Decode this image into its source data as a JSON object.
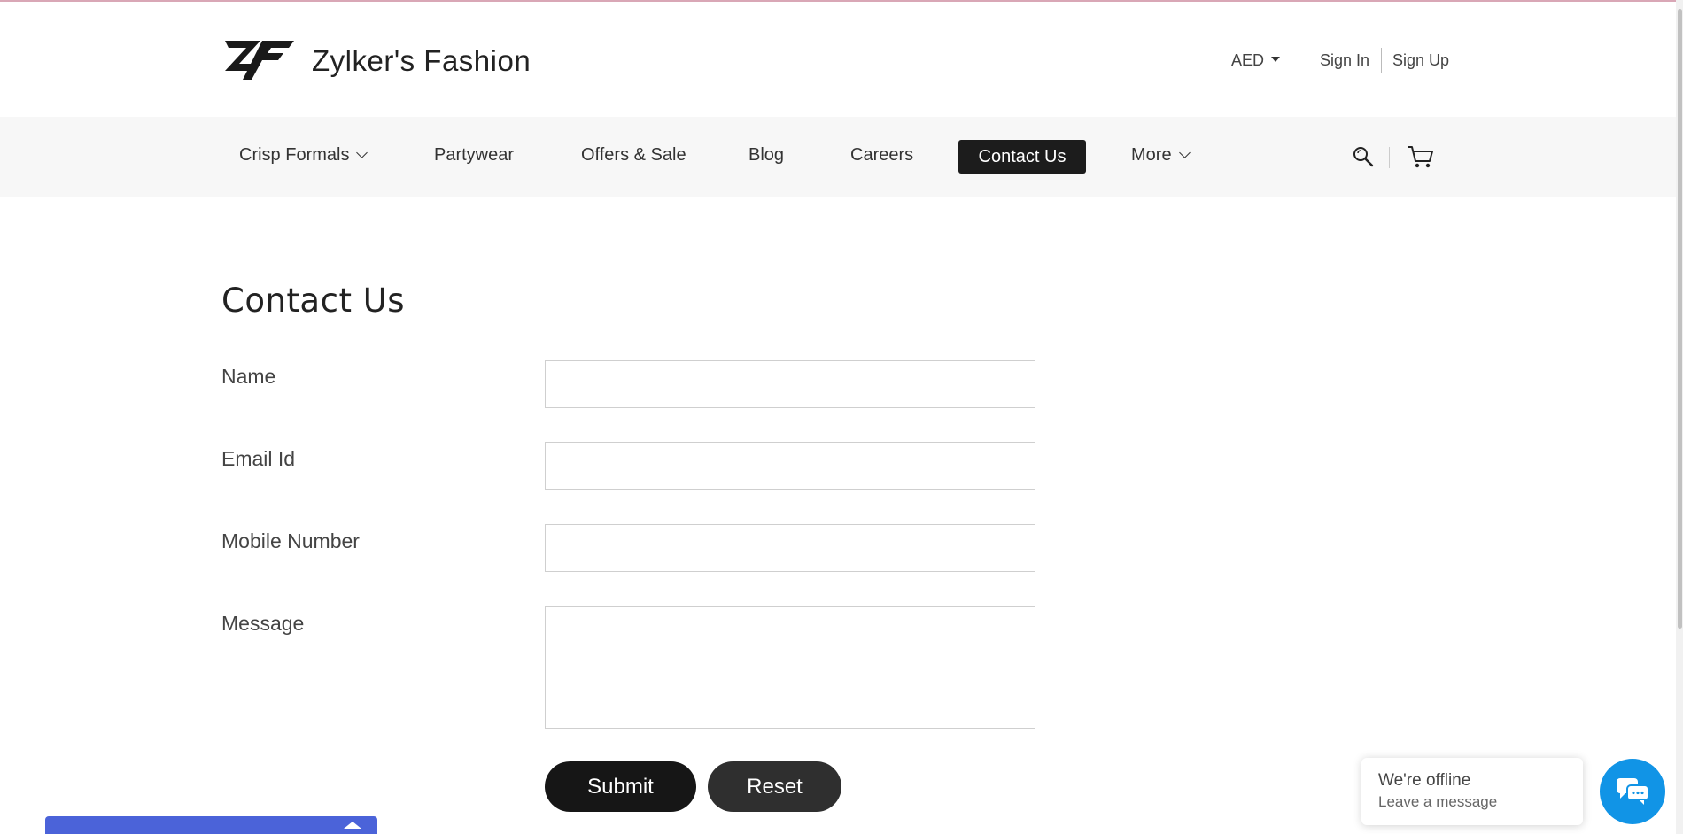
{
  "colors": {
    "accent_dark": "#1c1c1c",
    "chat_blue": "#1194e6",
    "bottom_bar": "#4b63d9",
    "nav_bg": "#f7f7f7"
  },
  "header": {
    "brand": "Zylker's Fashion",
    "logo_icon": "zf-logo-icon",
    "currency": "AED",
    "sign_in": "Sign In",
    "sign_up": "Sign Up"
  },
  "nav": {
    "items": [
      {
        "label": "Crisp Formals",
        "has_dropdown": true
      },
      {
        "label": "Partywear"
      },
      {
        "label": "Offers & Sale"
      },
      {
        "label": "Blog"
      },
      {
        "label": "Careers"
      },
      {
        "label": "Contact Us",
        "active": true
      },
      {
        "label": "More",
        "has_dropdown": true
      }
    ],
    "icons": [
      "search-icon",
      "cart-icon"
    ]
  },
  "form": {
    "title": "Contact Us",
    "fields": [
      {
        "label": "Name",
        "value": ""
      },
      {
        "label": "Email Id",
        "value": ""
      },
      {
        "label": "Mobile Number",
        "value": ""
      },
      {
        "label": "Message",
        "value": ""
      }
    ],
    "submit_label": "Submit",
    "reset_label": "Reset"
  },
  "chat": {
    "title": "We're offline",
    "subtitle": "Leave a message",
    "icon": "chat-icon"
  }
}
